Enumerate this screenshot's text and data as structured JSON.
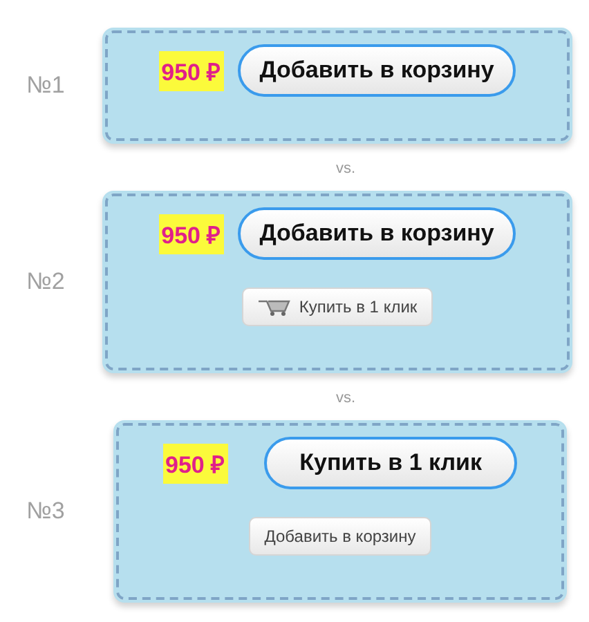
{
  "variants": [
    {
      "label": "№1",
      "price": "950 ₽",
      "primary": "Добавить в корзину"
    },
    {
      "label": "№2",
      "price": "950 ₽",
      "primary": "Добавить в корзину",
      "secondary": {
        "label": "Купить в 1 клик",
        "cart_icon": true
      }
    },
    {
      "label": "№3",
      "price": "950 ₽",
      "primary": "Купить в 1 клик",
      "secondary": {
        "label": "Добавить в корзину",
        "cart_icon": false
      }
    }
  ],
  "separators": [
    "vs.",
    "vs."
  ]
}
